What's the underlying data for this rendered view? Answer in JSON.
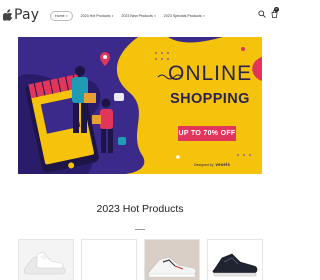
{
  "header": {
    "logo_text": "Pay",
    "logo_icon": "apple-logo-icon",
    "nav": [
      {
        "label": "Home",
        "active": true
      },
      {
        "label": "2023 Hot Products",
        "active": false
      },
      {
        "label": "2023 New Products",
        "active": false
      },
      {
        "label": "2023 Specials Products",
        "active": false
      }
    ],
    "icons": [
      "search-icon",
      "cart-icon"
    ],
    "cart_count": "0"
  },
  "banner": {
    "title": "ONLINE",
    "subtitle": "SHOPPING",
    "badge": "UP TO 70% OFF",
    "credit_prefix": "Designed by",
    "credit_brand": "vexels",
    "colors": {
      "background": "#f5c30c",
      "text": "#2a2350",
      "badge": "#e2355c"
    }
  },
  "section": {
    "title": "2023 Hot Products"
  },
  "products": [
    {
      "name": "white-sneakers-product"
    },
    {
      "name": "blank-product"
    },
    {
      "name": "white-running-shoe-product"
    },
    {
      "name": "black-running-shoe-product"
    }
  ]
}
